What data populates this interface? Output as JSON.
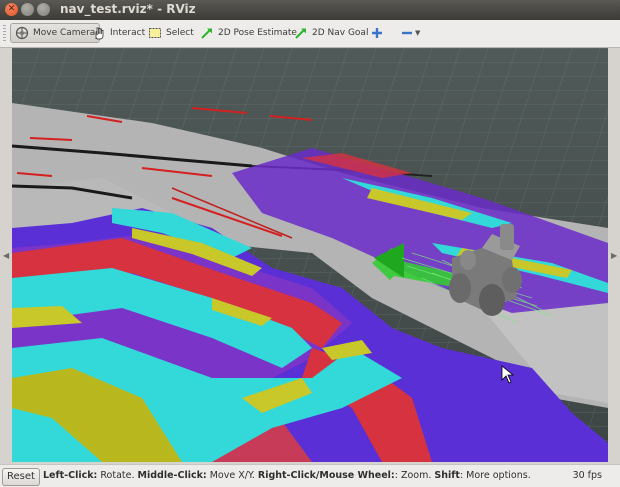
{
  "window": {
    "title": "nav_test.rviz* - RViz"
  },
  "toolbar": {
    "move_camera": "Move Camera",
    "interact": "Interact",
    "select": "Select",
    "pose_estimate": "2D Pose Estimate",
    "nav_goal": "2D Nav Goal",
    "add_tool_icon": "plus-icon",
    "remove_tool_icon": "minus-icon"
  },
  "status": {
    "reset_label": "Reset",
    "hint_left_click": "Left-Click:",
    "hint_left_action": " Rotate. ",
    "hint_middle_click": "Middle-Click:",
    "hint_middle_action": " Move X/Y. ",
    "hint_right_click": "Right-Click/Mouse Wheel:",
    "hint_right_action": ": Zoom. ",
    "hint_shift": "Shift",
    "hint_shift_action": ": More options.",
    "fps": "30 fps"
  },
  "colors": {
    "grid": "#4e5a58",
    "floor": "#b4b4b4",
    "costmap_purple": "#6a2bc9",
    "costmap_red": "#d6323f",
    "costmap_cyan": "#33d8d8",
    "costmap_yellow": "#b8b81e",
    "goal_arrow": "#33cc33",
    "robot": "#808080"
  }
}
